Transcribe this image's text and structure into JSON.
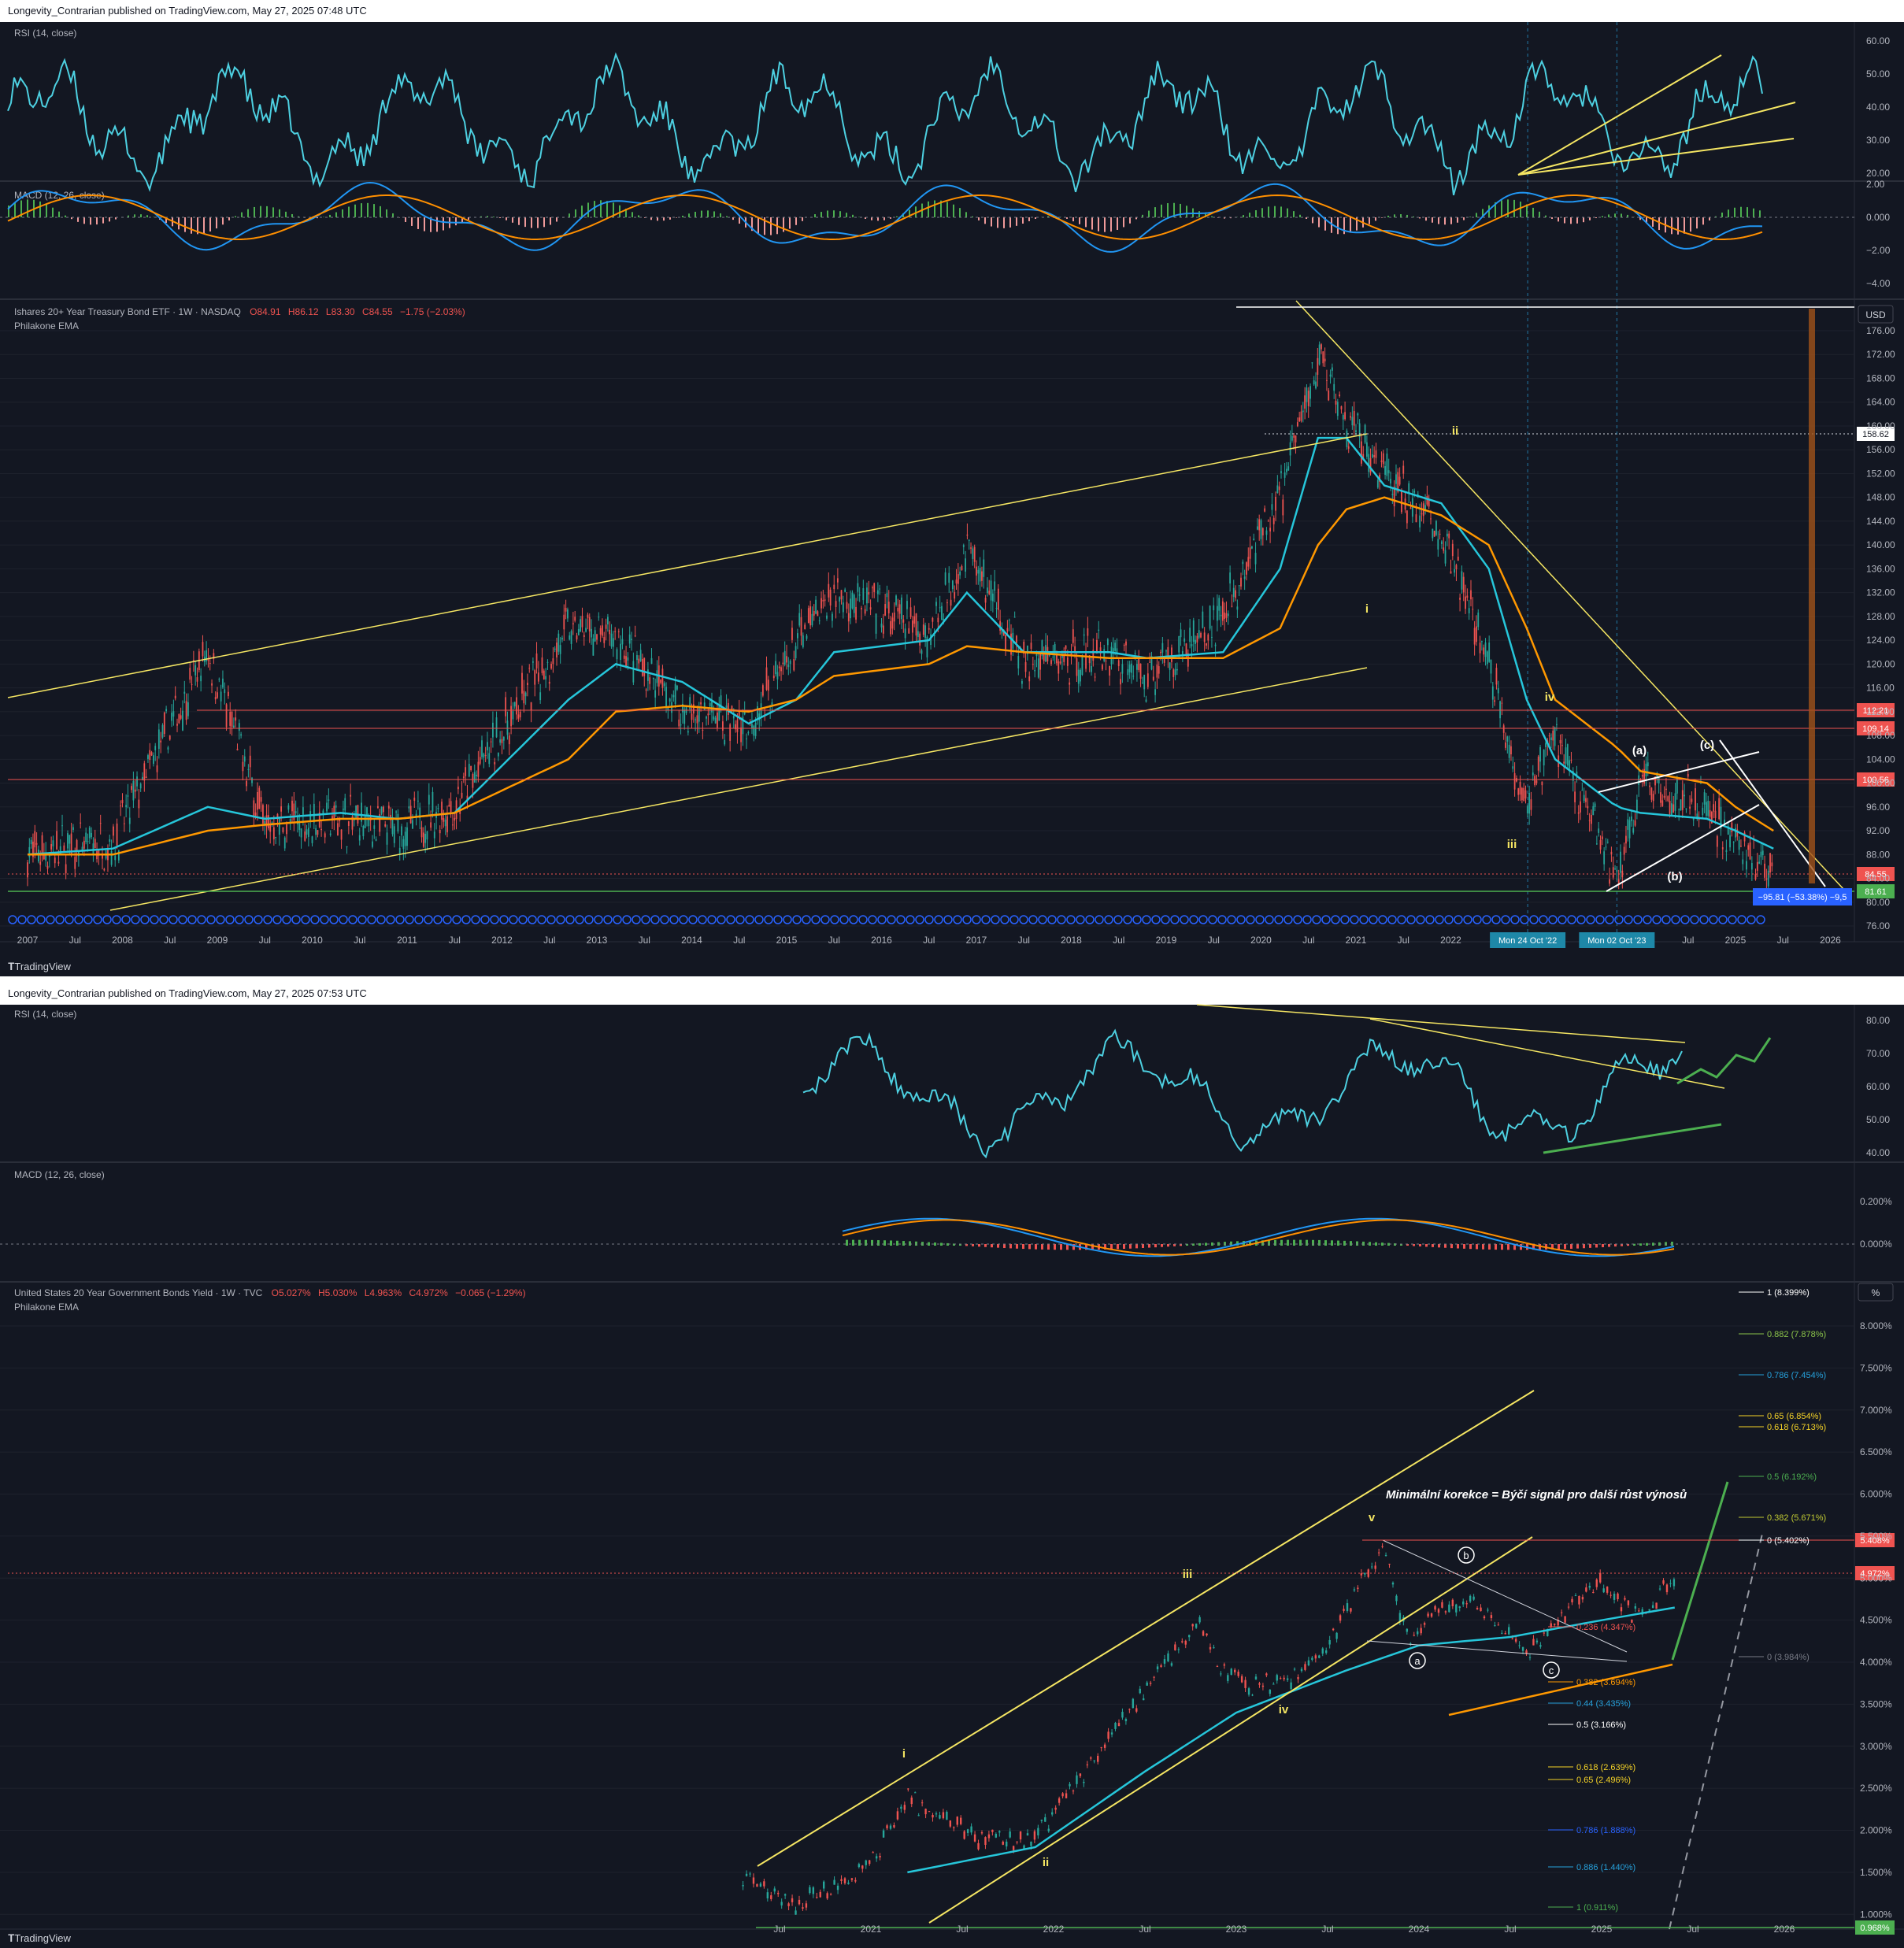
{
  "top": {
    "publisher": "Longevity_Contrarian published on TradingView.com, May 27, 2025 07:48 UTC",
    "rsi_label": "RSI (14, close)",
    "macd_label": "MACD (12, 26, close)",
    "symbol_title": "Ishares 20+ Year Treasury Bond ETF · 1W · NASDAQ",
    "ohlc": {
      "open": "O84.91",
      "high": "H86.12",
      "low": "L83.30",
      "close": "C84.55",
      "change": "−1.75 (−2.03%)"
    },
    "indicator": "Philakone EMA",
    "currency": "USD",
    "logo": "TradingView",
    "rsi_ticks": [
      "60.00",
      "50.00",
      "40.00",
      "30.00",
      "20.00"
    ],
    "macd_ticks": [
      "2.00",
      "0.000",
      "−2.00",
      "−4.00"
    ],
    "price_ticks": [
      "176.00",
      "172.00",
      "168.00",
      "164.00",
      "160.00",
      "156.00",
      "152.00",
      "148.00",
      "144.00",
      "140.00",
      "136.00",
      "132.00",
      "128.00",
      "124.00",
      "120.00",
      "116.00",
      "112.00",
      "108.00",
      "104.00",
      "100.00",
      "96.00",
      "92.00",
      "88.00",
      "84.00",
      "80.00",
      "76.00"
    ],
    "price_tags": {
      "high": "158.62",
      "r1": "112.21",
      "r2": "109.14",
      "r3": "100.56",
      "last": "84.55",
      "support": "81.61"
    },
    "measure_label": "−95.81 (−53.38%) −9,5",
    "time_labels": [
      "2007",
      "Jul",
      "2008",
      "Jul",
      "2009",
      "Jul",
      "2010",
      "Jul",
      "2011",
      "Jul",
      "2012",
      "Jul",
      "2013",
      "Jul",
      "2014",
      "Jul",
      "2015",
      "Jul",
      "2016",
      "Jul",
      "2017",
      "Jul",
      "2018",
      "Jul",
      "2019",
      "Jul",
      "2020",
      "Jul",
      "2021",
      "Jul",
      "2022",
      "Jul",
      "2023",
      "Jul",
      "2024",
      "Jul",
      "2025",
      "Jul",
      "2026"
    ],
    "date_tags": [
      "Mon 24 Oct '22",
      "Mon 02 Oct '23"
    ],
    "waves": {
      "i": "i",
      "ii": "ii",
      "iii": "iii",
      "iv": "iv",
      "a": "(a)",
      "b": "(b)",
      "c": "(c)"
    }
  },
  "bottom": {
    "publisher": "Longevity_Contrarian published on TradingView.com, May 27, 2025 07:53 UTC",
    "rsi_label": "RSI (14, close)",
    "macd_label": "MACD (12, 26, close)",
    "symbol_title": "United States 20 Year Government Bonds Yield · 1W · TVC",
    "ohlc": {
      "open": "O5.027%",
      "high": "H5.030%",
      "low": "L4.963%",
      "close": "C4.972%",
      "change": "−0.065 (−1.29%)"
    },
    "indicator": "Philakone EMA",
    "currency": "%",
    "logo": "TradingView",
    "rsi_ticks": [
      "80.00",
      "70.00",
      "60.00",
      "50.00",
      "40.00"
    ],
    "macd_ticks": [
      "0.200%",
      "0.000%"
    ],
    "price_ticks": [
      "8.000%",
      "7.500%",
      "7.000%",
      "6.500%",
      "6.000%",
      "5.500%",
      "5.000%",
      "4.500%",
      "4.000%",
      "3.500%",
      "3.000%",
      "2.500%",
      "2.000%",
      "1.500%",
      "1.000%"
    ],
    "price_tags": {
      "high": "5.408%",
      "last": "4.972%",
      "low": "0.968%"
    },
    "fib_upper": [
      {
        "label": "1 (8.399%)",
        "color": "#ffffff"
      },
      {
        "label": "0.882 (7.878%)",
        "color": "#8bc34a"
      },
      {
        "label": "0.786 (7.454%)",
        "color": "#26a0da"
      },
      {
        "label": "0.65 (6.854%)",
        "color": "#f5d327"
      },
      {
        "label": "0.618 (6.713%)",
        "color": "#f5d327"
      },
      {
        "label": "0.5 (6.192%)",
        "color": "#4caf50"
      },
      {
        "label": "0.382 (5.671%)",
        "color": "#c0ca33"
      },
      {
        "label": "0 (5.402%)",
        "color": "#ffffff"
      }
    ],
    "fib_lower": [
      {
        "label": "0.236 (4.347%)",
        "color": "#ef5350"
      },
      {
        "label": "0 (3.984%)",
        "color": "#787b86"
      },
      {
        "label": "0.382 (3.694%)",
        "color": "#ff9800"
      },
      {
        "label": "0.44 (3.435%)",
        "color": "#26a0da"
      },
      {
        "label": "0.5 (3.166%)",
        "color": "#ffffff"
      },
      {
        "label": "0.618 (2.639%)",
        "color": "#f5d327"
      },
      {
        "label": "0.65 (2.496%)",
        "color": "#f5d327"
      },
      {
        "label": "0.786 (1.888%)",
        "color": "#2962ff"
      },
      {
        "label": "0.886 (1.440%)",
        "color": "#26a0da"
      },
      {
        "label": "1 (0.911%)",
        "color": "#4caf50"
      }
    ],
    "annotation": "Minimální korekce = Býčí signál pro další růst výnosů",
    "time_labels": [
      "Jul",
      "2021",
      "Jul",
      "2022",
      "Jul",
      "2023",
      "Jul",
      "2024",
      "Jul",
      "2025",
      "Jul",
      "2026"
    ],
    "waves": {
      "i": "i",
      "ii": "ii",
      "iii": "iii",
      "iv": "iv",
      "v": "v",
      "a": "a",
      "b": "b",
      "c": "c"
    }
  },
  "colors": {
    "bg": "#131722",
    "rsi": "#4dd0e1",
    "macd_fast": "#2196f3",
    "macd_slow": "#ff8f00",
    "up": "#26a69a",
    "down": "#ef5350",
    "ema_fast": "#26c6da",
    "ema_slow": "#ff9800",
    "trend": "#f5e663"
  },
  "chart_data": [
    {
      "type": "line",
      "title": "Ishares 20+ Year Treasury Bond ETF · 1W · NASDAQ",
      "x": [
        "2007",
        "2008",
        "2009",
        "2010",
        "2011",
        "2012",
        "2013",
        "2014",
        "2015",
        "2016",
        "2017",
        "2018",
        "2019",
        "2020",
        "2021",
        "2022",
        "2023",
        "2024",
        "2025"
      ],
      "series": [
        {
          "name": "Ishares 20+ Year Treasury Bond ETF",
          "values": [
            88,
            91,
            108,
            92,
            95,
            118,
            122,
            106,
            125,
            128,
            122,
            121,
            122,
            148,
            158,
            138,
            98,
            92,
            90
          ]
        },
        {
          "name": "Philakone EMA",
          "values": [
            88,
            89,
            98,
            95,
            94,
            106,
            116,
            110,
            116,
            122,
            121,
            121,
            120,
            140,
            150,
            140,
            108,
            96,
            91
          ]
        }
      ],
      "ylim": [
        76,
        178
      ],
      "annotations": [
        "i",
        "ii",
        "iii",
        "iv",
        "(a)",
        "(b)",
        "(c)",
        "−95.81 (−53.38%) −9,5"
      ]
    },
    {
      "type": "line",
      "title": "United States 20 Year Government Bonds Yield · 1W · TVC",
      "x": [
        "2020-07",
        "2021-01",
        "2021-07",
        "2022-01",
        "2022-07",
        "2023-01",
        "2023-07",
        "2023-10",
        "2024-01",
        "2024-07",
        "2025-01",
        "2025-05"
      ],
      "series": [
        {
          "name": "United States 20 Year Government Bonds Yield",
          "values": [
            1.3,
            1.6,
            2.1,
            1.9,
            3.4,
            3.9,
            4.2,
            5.4,
            4.3,
            4.5,
            4.8,
            4.972
          ]
        },
        {
          "name": "Philakone EMA",
          "values": [
            null,
            null,
            null,
            1.8,
            2.6,
            3.3,
            3.8,
            4.2,
            4.4,
            4.4,
            4.5,
            4.65
          ]
        }
      ],
      "ylim": [
        0.9,
        8.5
      ],
      "annotations": [
        "i",
        "ii",
        "iii",
        "iv",
        "v",
        "a",
        "b",
        "c",
        "Minimální korekce = Býčí signál pro další růst výnosů"
      ]
    }
  ]
}
